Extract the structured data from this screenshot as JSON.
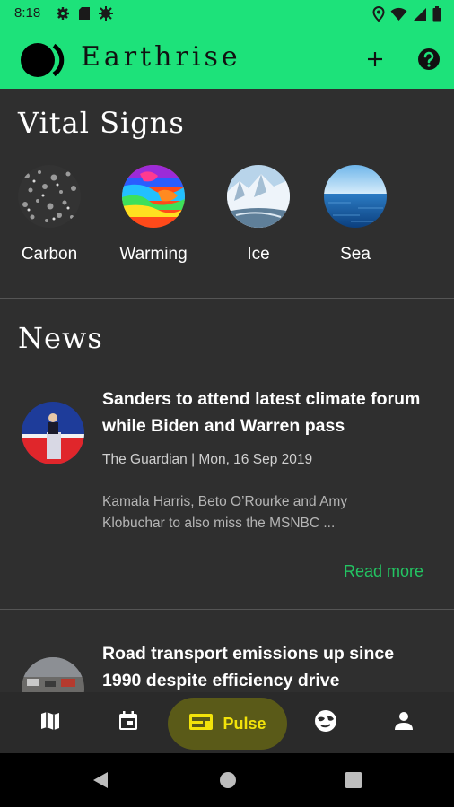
{
  "status_bar": {
    "time": "8:18",
    "left_icons": [
      "gear-icon",
      "sd-card-icon",
      "bug-icon"
    ],
    "right_icons": [
      "location-icon",
      "wifi-icon",
      "signal-icon",
      "battery-icon"
    ]
  },
  "app_bar": {
    "title": "Earthrise",
    "actions": [
      "add-icon",
      "help-icon"
    ]
  },
  "vital_signs": {
    "title": "Vital Signs",
    "items": [
      {
        "label": "Carbon",
        "icon": "carbon-image"
      },
      {
        "label": "Warming",
        "icon": "warming-map-image"
      },
      {
        "label": "Ice",
        "icon": "ice-image"
      },
      {
        "label": "Sea",
        "icon": "sea-image"
      }
    ]
  },
  "news": {
    "title": "News",
    "items": [
      {
        "headline": "Sanders to attend latest climate forum while Biden and Warren pass",
        "source": "The Guardian | Mon, 16 Sep 2019",
        "snippet": "Kamala Harris, Beto O’Rourke and Amy Klobuchar to also miss the MSNBC ...",
        "read_more": "Read more"
      },
      {
        "headline": "Road transport emissions up since 1990 despite efficiency drive"
      }
    ]
  },
  "bottom_nav": {
    "items": [
      {
        "icon": "map-icon"
      },
      {
        "icon": "calendar-icon"
      },
      {
        "icon": "pulse-icon",
        "label": "Pulse",
        "active": true
      },
      {
        "icon": "earth-icon"
      },
      {
        "icon": "person-icon"
      }
    ]
  },
  "colors": {
    "accent": "#1de27a",
    "active_pill": "#5a5a18",
    "active_text": "#f2e30a",
    "link": "#23c462",
    "background": "#2f2f2f"
  }
}
